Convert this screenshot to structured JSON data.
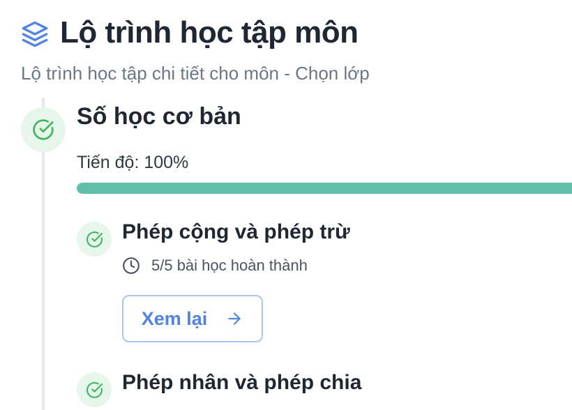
{
  "header": {
    "icon": "layers-icon",
    "title": "Lộ trình học tập môn",
    "subtitle": "Lộ trình học tập chi tiết cho môn - Chọn lớp"
  },
  "module": {
    "title": "Số học cơ bản",
    "status_icon": "check-circle-icon",
    "progress_label": "Tiến độ: 100%",
    "progress": 1.0,
    "colors": {
      "progress_fill": "#5fbfa9",
      "check": "#3fb55f",
      "check_bg": "#e6f6ea",
      "accent": "#4f83e6"
    }
  },
  "lessons": [
    {
      "title": "Phép cộng và phép trừ",
      "status_icon": "check-circle-icon",
      "meta_icon": "clock-icon",
      "meta": "5/5 bài học hoàn thành",
      "button_label": "Xem lại",
      "button_icon": "arrow-right-icon"
    },
    {
      "title": "Phép nhân và phép chia",
      "status_icon": "check-circle-icon"
    }
  ]
}
